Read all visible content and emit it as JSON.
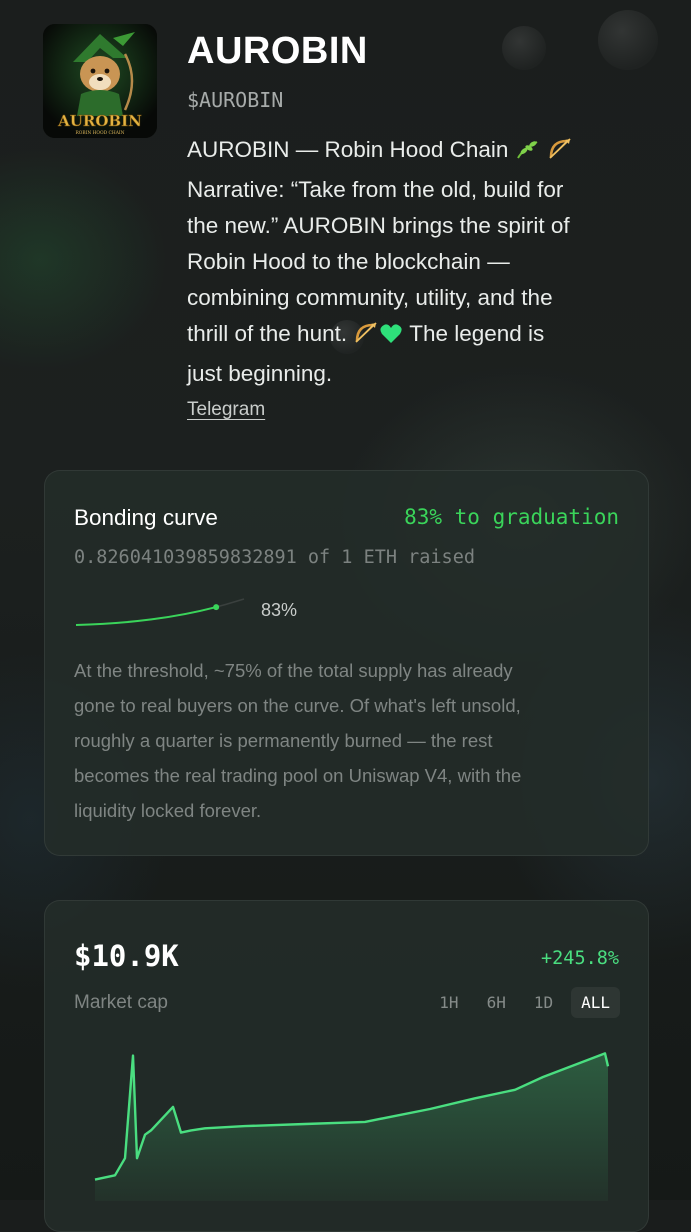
{
  "token": {
    "name": "AUROBIN",
    "ticker": "$AUROBIN",
    "logo_text": "AUROBIN",
    "logo_subtext": "ROBIN HOOD CHAIN",
    "description_lines": [
      "AUROBIN — Robin Hood Chain",
      "Narrative: “Take from the old, build for",
      "the new.” AUROBIN brings the spirit of",
      "Robin Hood to the blockchain —",
      "combining community, utility, and the",
      "thrill of the hunt.",
      "The legend is",
      "just beginning."
    ],
    "link_label": "Telegram"
  },
  "bonding_curve": {
    "title": "Bonding curve",
    "graduation_text": "83% to graduation",
    "raised_text": "0.826041039859832891 of 1 ETH raised",
    "progress_percent": 83,
    "progress_label": "83%",
    "explanation_lines": [
      "At the threshold, ~75% of the total supply has already",
      "gone to real buyers on the curve. Of what's left unsold,",
      "roughly a quarter is permanently burned — the rest",
      "becomes the real trading pool on Uniswap V4, with the",
      "liquidity locked forever."
    ]
  },
  "market": {
    "value": "$10.9K",
    "change": "+245.8%",
    "label": "Market cap",
    "ranges": [
      "1H",
      "6H",
      "1D",
      "ALL"
    ],
    "active_range": "ALL"
  },
  "colors": {
    "accent_green": "#3ad45a",
    "chart_green": "#4ade80",
    "card_bg": "#232c29"
  },
  "chart_data": {
    "type": "area",
    "series": [
      {
        "values": [
          1.0,
          1.2,
          2.0,
          6.8,
          2.0,
          3.1,
          3.3,
          4.4,
          3.2,
          3.3,
          3.4,
          3.5,
          3.6,
          3.7,
          4.3,
          4.8,
          5.2,
          5.8,
          6.9,
          6.3
        ]
      }
    ]
  }
}
